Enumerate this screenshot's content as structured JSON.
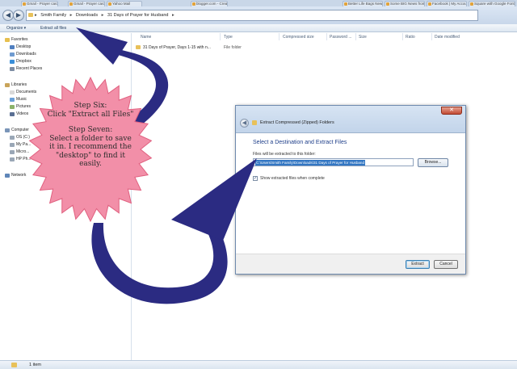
{
  "colors": {
    "arrow": "#2b2b82",
    "burst_fill": "#f28fa8",
    "burst_stroke": "#e0607f",
    "selection": "#3276c3",
    "dialog_heading": "#1f3f8a"
  },
  "browser_tabs": [
    {
      "label": "Gmail - Prayer cards"
    },
    {
      "label": "Gmail - Prayer cards - ..."
    },
    {
      "label": "Yahoo Mail"
    },
    {
      "label": "blogger.com - Create Post"
    },
    {
      "label": "Better Life Bags Newsletter"
    },
    {
      "label": "Some BIG News from ..."
    },
    {
      "label": "Facebook | My Account"
    },
    {
      "label": "Square with Google Fonts"
    }
  ],
  "address_bar": {
    "crumbs": [
      "Smith Family",
      "Downloads",
      "31 Days of Prayer for Husband"
    ],
    "separator": "▸"
  },
  "toolbar": {
    "organize": "Organize ▾",
    "extract": "Extract all files"
  },
  "nav": {
    "favorites": "Favorites",
    "desktop": "Desktop",
    "downloads": "Downloads",
    "dropbox": "Dropbox",
    "recent": "Recent Places",
    "libraries": "Libraries",
    "documents": "Documents",
    "music": "Music",
    "pictures": "Pictures",
    "videos": "Videos",
    "computer": "Computer",
    "os": "OS (C:)",
    "my_pa": "My Pa...",
    "micro": "Micro...",
    "hp": "HP Ph...",
    "network": "Network"
  },
  "columns": [
    "Name",
    "Type",
    "Compressed size",
    "Password ...",
    "Size",
    "Ratio",
    "Date modified"
  ],
  "files": [
    {
      "name": "31 Days of Prayer, Days 1-15 with n...",
      "type": "File folder"
    }
  ],
  "status": {
    "count": "1 item"
  },
  "note": {
    "step6_title": "Step Six:",
    "step6_body": "Click \"Extract all Files\"",
    "step7_title": "Step Seven:",
    "step7_l1": "Select a folder to save",
    "step7_l2": "it in.  I recommend the",
    "step7_l3": "\"desktop\" to find it",
    "step7_l4": "easily."
  },
  "dialog": {
    "close": "✕",
    "back": "◀",
    "caption": "Extract Compressed (Zipped) Folders",
    "heading": "Select a Destination and Extract Files",
    "label": "Files will be extracted to this folder:",
    "path": "C:\\Users\\Smith Family\\Downloads\\31 Days of Prayer for Husband",
    "browse": "Browse...",
    "check_mark": "✓",
    "check_label": "Show extracted files when complete",
    "extract": "Extract",
    "cancel": "Cancel"
  }
}
